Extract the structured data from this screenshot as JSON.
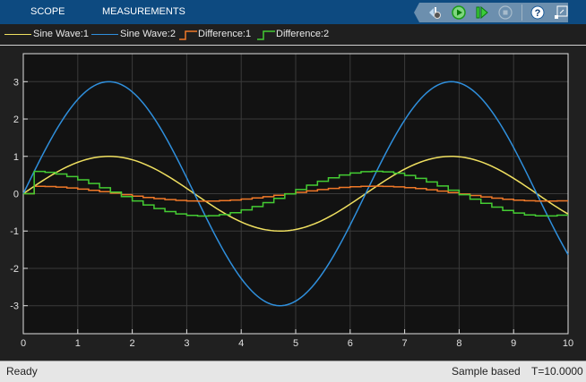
{
  "tabs": [
    {
      "label": "SCOPE"
    },
    {
      "label": "MEASUREMENTS"
    }
  ],
  "toolbar": [
    "settings-icon",
    "run-icon",
    "step-forward-icon",
    "stop-icon",
    "help-icon",
    "undock-icon"
  ],
  "legend": [
    {
      "label": "Sine Wave:1",
      "color": "#f0e060"
    },
    {
      "label": "Sine Wave:2",
      "color": "#2f8fdc"
    },
    {
      "label": "Difference:1",
      "color": "#f07828"
    },
    {
      "label": "Difference:2",
      "color": "#44cc33"
    }
  ],
  "status": {
    "left": "Ready",
    "mode": "Sample based",
    "time": "T=10.0000"
  },
  "chart_data": {
    "type": "line",
    "xlim": [
      0,
      10
    ],
    "ylim": [
      -3.75,
      3.75
    ],
    "grid": true,
    "xticks": [
      "0",
      "1",
      "2",
      "3",
      "4",
      "5",
      "6",
      "7",
      "8",
      "9",
      "10"
    ],
    "yticks": [
      "3",
      "2",
      "1",
      "0",
      "-1",
      "-2",
      "-3"
    ],
    "series": [
      {
        "name": "Sine Wave:1",
        "kind": "sine",
        "amplitude": 1,
        "frequency_rad_per_s": 1
      },
      {
        "name": "Sine Wave:2",
        "kind": "sine",
        "amplitude": 3,
        "frequency_rad_per_s": 1
      },
      {
        "name": "Difference:1",
        "kind": "stairs",
        "of_amplitude": 1,
        "sample_time": 0.2,
        "peak": 0.2
      },
      {
        "name": "Difference:2",
        "kind": "stairs",
        "of_amplitude": 3,
        "sample_time": 0.2,
        "peak": 0.6
      }
    ]
  }
}
